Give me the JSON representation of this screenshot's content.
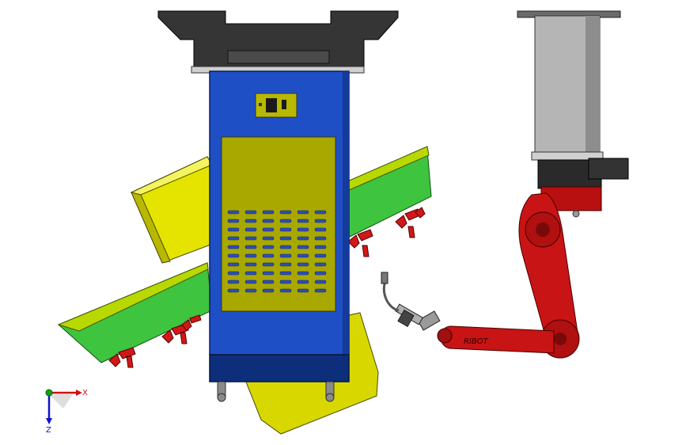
{
  "scene": {
    "colors": {
      "background": "#ffffff",
      "cabinet_blue": "#1f4fc4",
      "cabinet_dark": "#0d2e7a",
      "panel_olive": "#a8a800",
      "fixture_yellow": "#e4e400",
      "fixture_green": "#3ec43e",
      "robot_red": "#c81414",
      "robot_dark": "#2a2a2a",
      "column_gray": "#b5b5b5"
    },
    "axis_triad": {
      "x_label": "X",
      "z_label": "Z",
      "x_color": "#d01010",
      "y_color": "#10a010",
      "z_color": "#1010d0"
    },
    "robot_arm_marking": "RIBOT"
  }
}
